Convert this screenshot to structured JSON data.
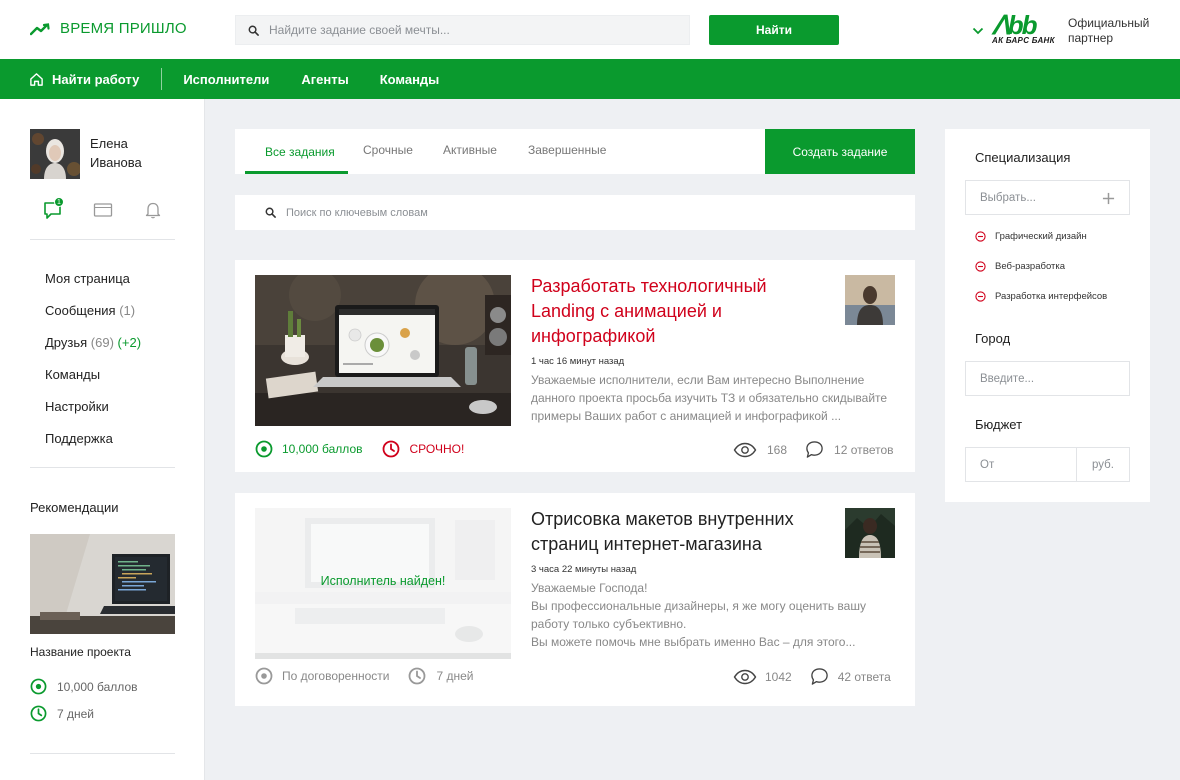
{
  "colors": {
    "accent": "#0a9a2e",
    "urgent": "#d0011b"
  },
  "header": {
    "logo_text": "ВРЕМЯ ПРИШЛО",
    "search_placeholder": "Найдите задание своей мечты...",
    "find_button": "Найти",
    "bank_logo_mark": "ᐱbb",
    "bank_logo_name": "АК БАРС БАНК",
    "partner_text": "Официальный партнер"
  },
  "nav": {
    "items": [
      "Найти работу",
      "Исполнители",
      "Агенты",
      "Команды"
    ]
  },
  "user": {
    "first_name": "Елена",
    "last_name": "Иванова",
    "message_badge": "1"
  },
  "menu": {
    "my_page": "Моя страница",
    "messages": "Сообщения",
    "messages_count": "(1)",
    "friends": "Друзья",
    "friends_count": "(69)",
    "friends_new": "(+2)",
    "teams": "Команды",
    "settings": "Настройки",
    "support": "Поддержка"
  },
  "recommendations": {
    "title": "Рекомендации",
    "project_name": "Название проекта",
    "points": "10,000 баллов",
    "duration": "7 дней"
  },
  "tabs": {
    "all": "Все задания",
    "urgent": "Срочные",
    "active": "Активные",
    "completed": "Завершенные",
    "create_button": "Создать задание"
  },
  "keyword_search_placeholder": "Поиск по ключевым словам",
  "tasks": [
    {
      "title": "Разработать технологичный Landing с анимацией и инфографикой",
      "time": "1 час 16 минут назад",
      "description": "Уважаемые исполнители, если Вам интересно Выполнение данного проекта просьба изучить ТЗ и обязательно скидывайте примеры Ваших работ с анимацией и инфографикой ...",
      "points": "10,000 баллов",
      "urgency": "СРОЧНО!",
      "views": "168",
      "answers": "12 ответов"
    },
    {
      "title": "Отрисовка макетов внутренних страниц интернет-магазина",
      "time": "3 часа 22 минуты назад",
      "description_line1": "Уважаемые Господа!",
      "description_line2": "Вы профессиональные дизайнеры, я же могу оценить вашу работу только субъективно.",
      "description_line3": "Вы можете помочь мне выбрать именно Вас – для этого...",
      "overlay": "Исполнитель найден!",
      "price": "По договоренности",
      "duration": "7 дней",
      "views": "1042",
      "answers": "42 ответа"
    }
  ],
  "filters": {
    "spec_title": "Специализация",
    "spec_placeholder": "Выбрать...",
    "spec_tags": [
      "Графический дизайн",
      "Веб-разработка",
      "Разработка интерфейсов"
    ],
    "city_title": "Город",
    "city_placeholder": "Введите...",
    "budget_title": "Бюджет",
    "budget_from": "От",
    "budget_currency": "руб."
  }
}
